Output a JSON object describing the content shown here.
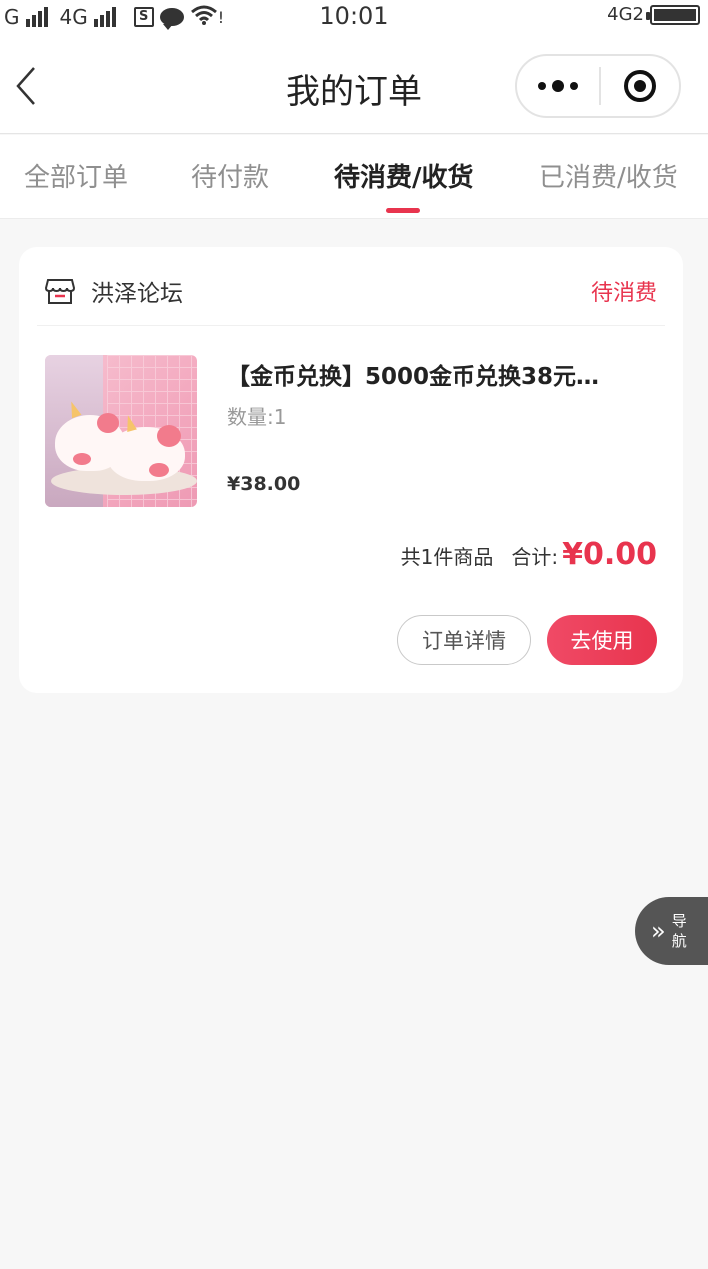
{
  "status_bar": {
    "carrier1": "G",
    "carrier2": "4G",
    "sim_label": "S",
    "wifi_extra": "!",
    "time": "10:01",
    "network_right": "4G2",
    "icons": [
      "signal-icon",
      "signal-icon",
      "sim-icon",
      "chat-bubble-icon",
      "wifi-icon",
      "battery-icon"
    ]
  },
  "navbar": {
    "title": "我的订单",
    "back_icon": "chevron-left-icon",
    "more_icon": "more-dots-icon",
    "close_icon": "target-circle-icon"
  },
  "tabs": [
    {
      "label": "全部订单",
      "active": false
    },
    {
      "label": "待付款",
      "active": false
    },
    {
      "label": "待消费/收货",
      "active": true
    },
    {
      "label": "已消费/收货",
      "active": false
    }
  ],
  "order": {
    "store_name": "洪泽论坛",
    "store_icon": "store-icon",
    "status": "待消费",
    "goods": {
      "title": "【金币兑换】5000金币兑换38元…",
      "quantity": "数量:1",
      "price": "¥38.00"
    },
    "summary": {
      "count_text": "共1件商品",
      "total_label": "合计:",
      "total_amount": "¥0.00"
    },
    "buttons": {
      "detail": "订单详情",
      "use": "去使用"
    }
  },
  "float_nav": {
    "arrow": "»",
    "label": "导航"
  },
  "colors": {
    "accent": "#e8344e",
    "background": "#f7f7f7",
    "card": "#ffffff",
    "float_nav": "#555555"
  }
}
